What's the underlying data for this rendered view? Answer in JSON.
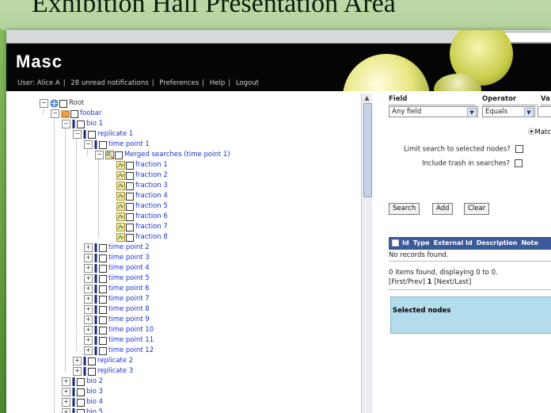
{
  "slide": {
    "title": "Exhibition Hall Presentation Area"
  },
  "app": {
    "logo": "Masc",
    "user_label": "User: Alice A",
    "notifications": "28 unread notifications",
    "preferences": "Preferences",
    "help": "Help",
    "logout": "Logout",
    "separator": "|"
  },
  "tree": [
    {
      "label": "Root",
      "depth": 0,
      "icon": "globe-icon",
      "exp": "−",
      "root": true
    },
    {
      "label": "foobar",
      "depth": 1,
      "icon": "folder-icon",
      "exp": "−"
    },
    {
      "label": "bio 1",
      "depth": 2,
      "icon": "bar-icon",
      "exp": "−"
    },
    {
      "label": "replicate 1",
      "depth": 3,
      "icon": "bar-icon",
      "exp": "−"
    },
    {
      "label": "time point 1",
      "depth": 4,
      "icon": "bar-icon",
      "exp": "−"
    },
    {
      "label": "Merged searches (time point 1)",
      "depth": 5,
      "icon": "merged-search-icon",
      "exp": "−"
    },
    {
      "label": "fraction 1",
      "depth": 6,
      "icon": "fraction-icon",
      "exp": ""
    },
    {
      "label": "fraction 2",
      "depth": 6,
      "icon": "fraction-icon",
      "exp": ""
    },
    {
      "label": "fraction 3",
      "depth": 6,
      "icon": "fraction-icon",
      "exp": ""
    },
    {
      "label": "fraction 4",
      "depth": 6,
      "icon": "fraction-icon",
      "exp": ""
    },
    {
      "label": "fraction 5",
      "depth": 6,
      "icon": "fraction-icon",
      "exp": ""
    },
    {
      "label": "fraction 6",
      "depth": 6,
      "icon": "fraction-icon",
      "exp": ""
    },
    {
      "label": "fraction 7",
      "depth": 6,
      "icon": "fraction-icon",
      "exp": ""
    },
    {
      "label": "fraction 8",
      "depth": 6,
      "icon": "fraction-icon",
      "exp": ""
    },
    {
      "label": "time point 2",
      "depth": 4,
      "icon": "bar-icon",
      "exp": "+"
    },
    {
      "label": "time point 3",
      "depth": 4,
      "icon": "bar-icon",
      "exp": "+"
    },
    {
      "label": "time point 4",
      "depth": 4,
      "icon": "bar-icon",
      "exp": "+"
    },
    {
      "label": "time point 5",
      "depth": 4,
      "icon": "bar-icon",
      "exp": "+"
    },
    {
      "label": "time point 6",
      "depth": 4,
      "icon": "bar-icon",
      "exp": "+"
    },
    {
      "label": "time point 7",
      "depth": 4,
      "icon": "bar-icon",
      "exp": "+"
    },
    {
      "label": "time point 8",
      "depth": 4,
      "icon": "bar-icon",
      "exp": "+"
    },
    {
      "label": "time point 9",
      "depth": 4,
      "icon": "bar-icon",
      "exp": "+"
    },
    {
      "label": "time point 10",
      "depth": 4,
      "icon": "bar-icon",
      "exp": "+"
    },
    {
      "label": "time point 11",
      "depth": 4,
      "icon": "bar-icon",
      "exp": "+"
    },
    {
      "label": "time point 12",
      "depth": 4,
      "icon": "bar-icon",
      "exp": "+"
    },
    {
      "label": "replicate 2",
      "depth": 3,
      "icon": "bar-icon",
      "exp": "+"
    },
    {
      "label": "replicate 3",
      "depth": 3,
      "icon": "bar-icon",
      "exp": "+"
    },
    {
      "label": "bio 2",
      "depth": 2,
      "icon": "bar-icon",
      "exp": "+"
    },
    {
      "label": "bio 3",
      "depth": 2,
      "icon": "bar-icon",
      "exp": "+"
    },
    {
      "label": "bio 4",
      "depth": 2,
      "icon": "bar-icon",
      "exp": "+"
    },
    {
      "label": "bio 5",
      "depth": 2,
      "icon": "bar-icon",
      "exp": "+"
    }
  ],
  "search": {
    "col_field": "Field",
    "col_operator": "Operator",
    "col_value": "Va",
    "field_value": "Any field",
    "operator_value": "Equals",
    "match_label": "Matc",
    "limit_label": "Limit search to selected nodes?",
    "trash_label": "Include trash in searches?",
    "search_button": "Search",
    "add_button": "Add",
    "clear_button": "Clear"
  },
  "results": {
    "columns": [
      "Id",
      "Type",
      "External Id",
      "Description",
      "Note"
    ],
    "no_records": "No records found.",
    "summary": "0 items found, displaying 0 to 0.",
    "pager_first": "[First/Prev]",
    "pager_page": "1",
    "pager_next": "[Next/Last]"
  },
  "selected_nodes": {
    "title": "Selected nodes"
  },
  "colors": {
    "link": "#1a33cc",
    "header_blue": "#3b5a9a",
    "selected_bg": "#b3dcec",
    "slide_green": "#5f9a3a"
  }
}
